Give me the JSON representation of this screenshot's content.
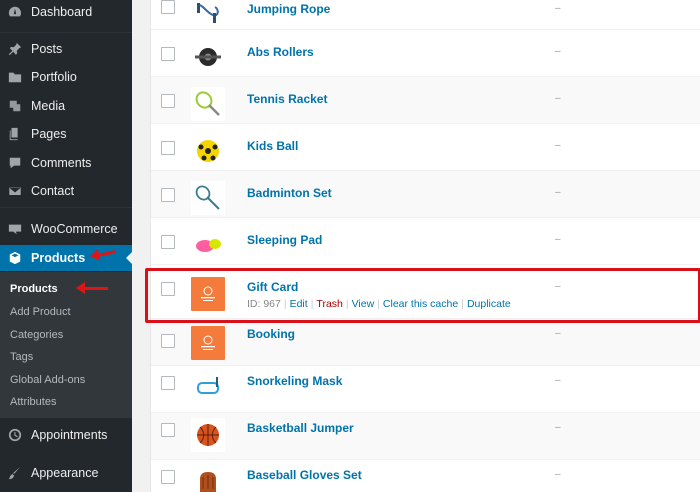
{
  "sidebar": {
    "items": [
      {
        "label": "Dashboard",
        "icon": "dashboard-icon"
      },
      {
        "label": "Posts",
        "icon": "pin-icon"
      },
      {
        "label": "Portfolio",
        "icon": "folder-icon"
      },
      {
        "label": "Media",
        "icon": "media-icon"
      },
      {
        "label": "Pages",
        "icon": "pages-icon"
      },
      {
        "label": "Comments",
        "icon": "comment-icon"
      },
      {
        "label": "Contact",
        "icon": "mail-icon"
      },
      {
        "label": "WooCommerce",
        "icon": "woo-icon"
      },
      {
        "label": "Products",
        "icon": "cube-icon"
      },
      {
        "label": "Appointments",
        "icon": "clock-icon"
      },
      {
        "label": "Appearance",
        "icon": "brush-icon"
      }
    ],
    "submenu": [
      "Products",
      "Add Product",
      "Categories",
      "Tags",
      "Global Add-ons",
      "Attributes"
    ]
  },
  "products": [
    {
      "name": "Jumping Rope",
      "thumb": "jump-rope"
    },
    {
      "name": "Abs Rollers",
      "thumb": "abs-roller"
    },
    {
      "name": "Tennis Racket",
      "thumb": "tennis-racket"
    },
    {
      "name": "Kids Ball",
      "thumb": "kids-ball"
    },
    {
      "name": "Badminton Set",
      "thumb": "badminton"
    },
    {
      "name": "Sleeping Pad",
      "thumb": "sleeping-pad"
    },
    {
      "name": "Gift Card",
      "thumb": "gift-card"
    },
    {
      "name": "Booking",
      "thumb": "booking"
    },
    {
      "name": "Snorkeling Mask",
      "thumb": "snorkel"
    },
    {
      "name": "Basketball Jumper",
      "thumb": "basketball"
    },
    {
      "name": "Baseball Gloves Set",
      "thumb": "baseball-glove"
    }
  ],
  "dash": "–",
  "gift_actions": {
    "id_label": "ID: 967",
    "edit": "Edit",
    "trash": "Trash",
    "view": "View",
    "clear_cache": "Clear this cache",
    "duplicate": "Duplicate",
    "separator": "|"
  },
  "colors": {
    "accent": "#0073aa",
    "sidebar": "#23282d",
    "highlight": "#d9101a"
  }
}
